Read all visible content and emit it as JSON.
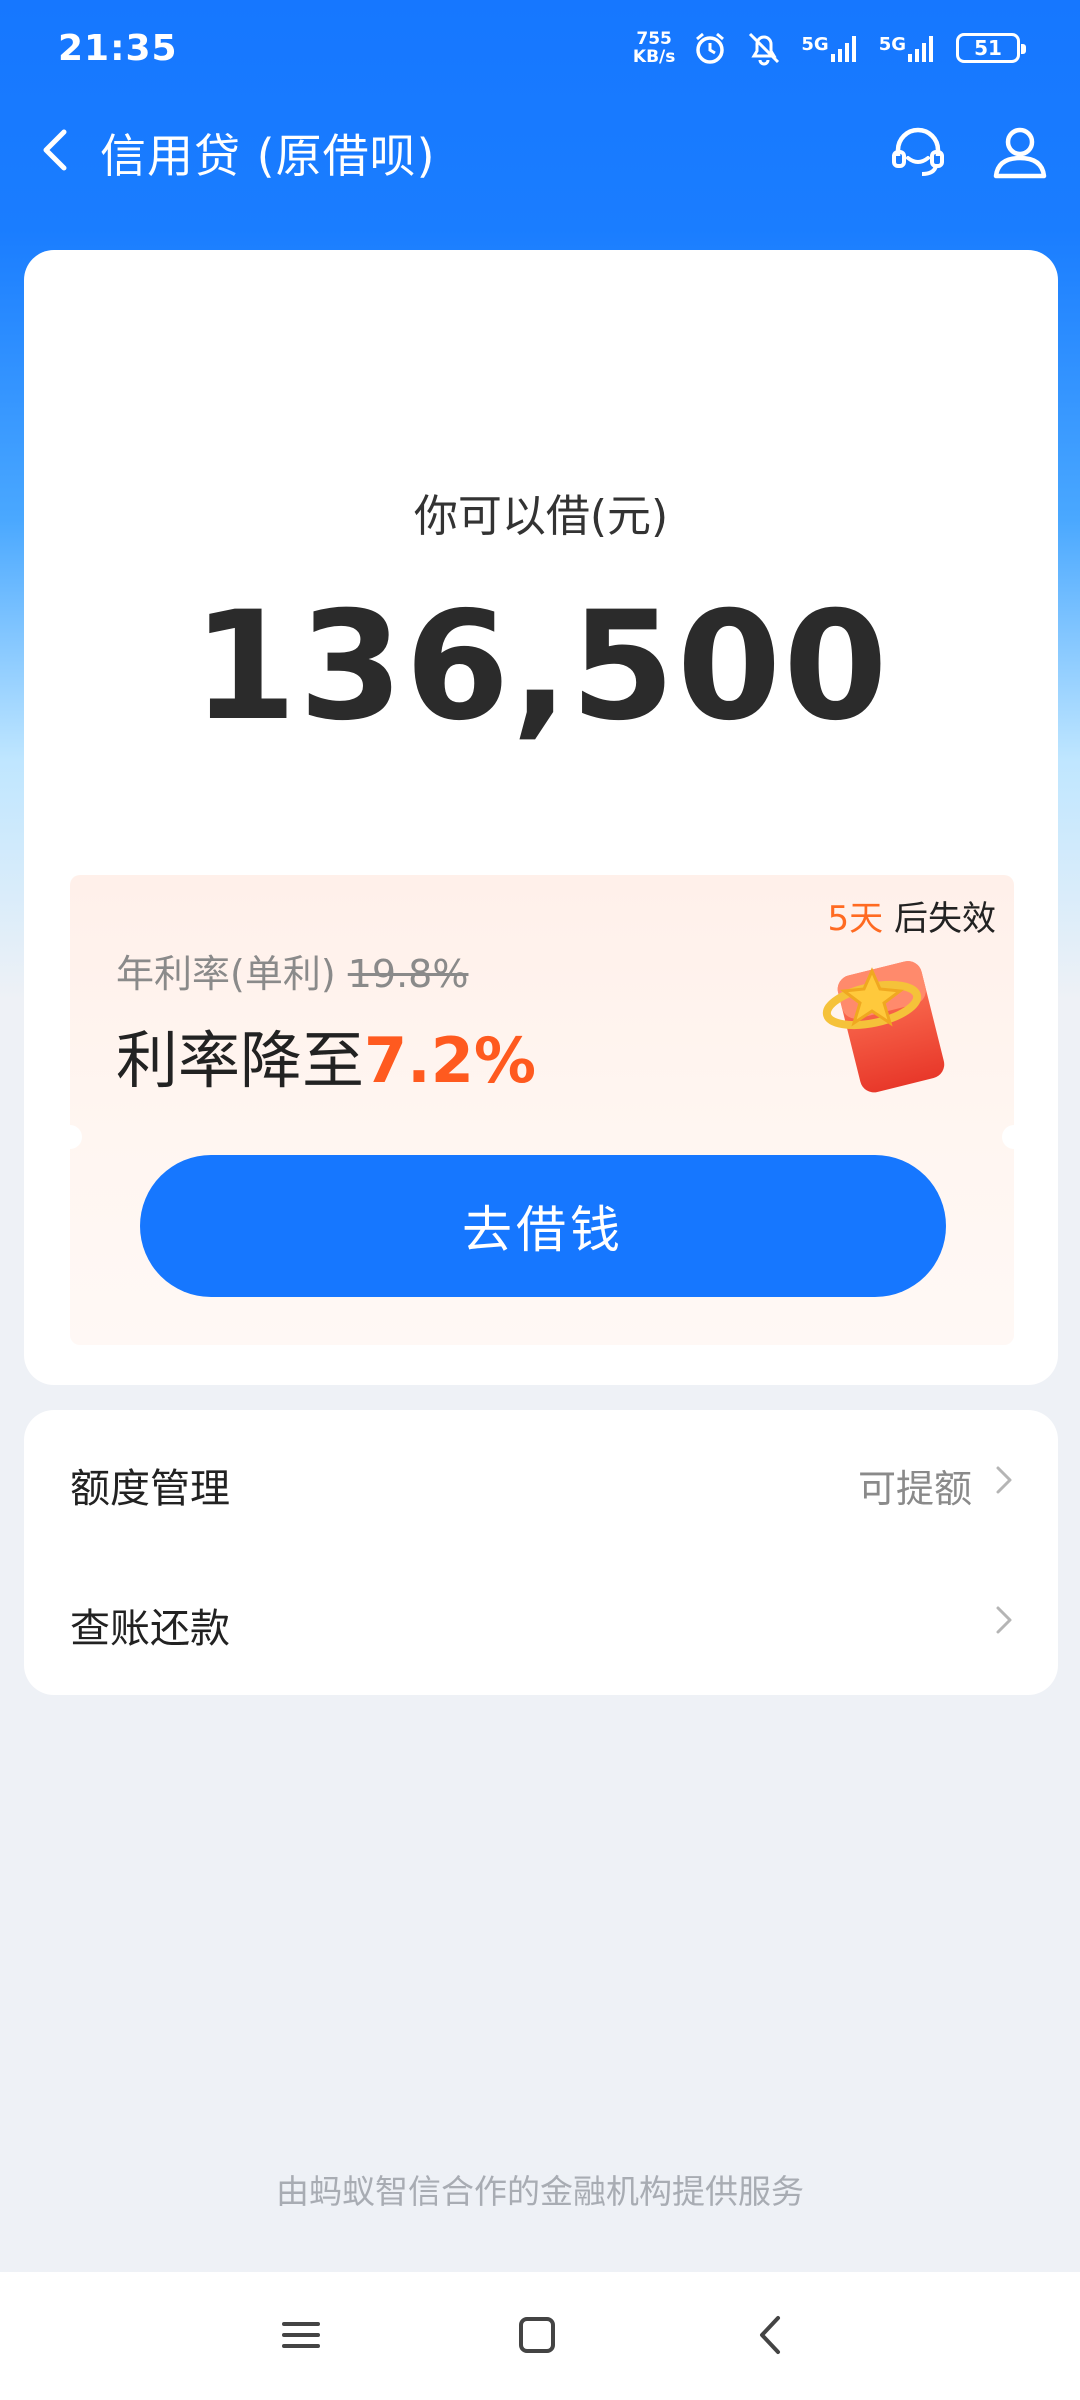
{
  "status_bar": {
    "time": "21:35",
    "net_speed_value": "755",
    "net_speed_unit": "KB/s",
    "signal1": "5G",
    "signal2": "5G",
    "battery": "51"
  },
  "header": {
    "title": "信用贷 (原借呗)"
  },
  "loan": {
    "label": "你可以借(元)",
    "amount": "136,500"
  },
  "promo": {
    "expire_days": "5天",
    "expire_text": "后失效",
    "rate_label": "年利率(单利)",
    "old_rate": "19.8%",
    "new_rate_prefix": "利率降至",
    "new_rate": "7.2%",
    "button_label": "去借钱"
  },
  "menu": [
    {
      "label": "额度管理",
      "hint": "可提额"
    },
    {
      "label": "查账还款",
      "hint": ""
    }
  ],
  "footer_note": "由蚂蚁智信合作的金融机构提供服务",
  "colors": {
    "brand_blue": "#1677ff",
    "accent_orange": "#ff5a1f",
    "page_bg": "#eef1f6"
  }
}
